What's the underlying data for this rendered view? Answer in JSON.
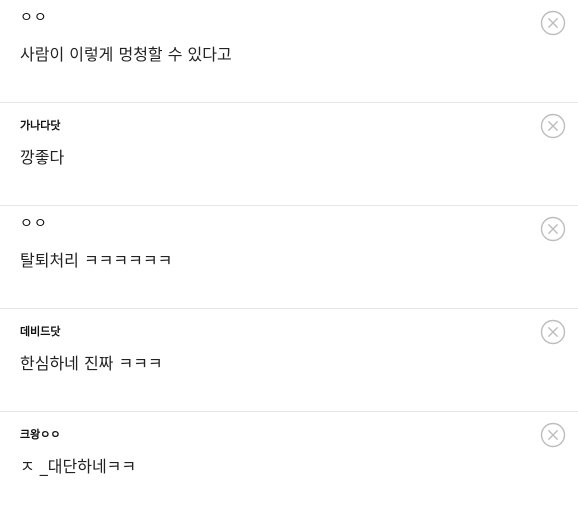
{
  "comments": [
    {
      "author": "ㅇㅇ",
      "text": "사람이 이렇게 멍청할 수 있다고"
    },
    {
      "author": "가나다닷",
      "text": "깡좋다"
    },
    {
      "author": "ㅇㅇ",
      "text": "탈퇴처리 ㅋㅋㅋㅋㅋㅋ"
    },
    {
      "author": "데비드닷",
      "text": "한심하네 진짜 ㅋㅋㅋ"
    },
    {
      "author": "크왕ㅇㅇ",
      "text": "ㅈ _대단하네ㅋㅋ"
    }
  ],
  "icons": {
    "delete": "close-circle-icon"
  },
  "colors": {
    "divider": "#e6e6e6",
    "icon": "#bdbdbd",
    "text": "#222222"
  }
}
